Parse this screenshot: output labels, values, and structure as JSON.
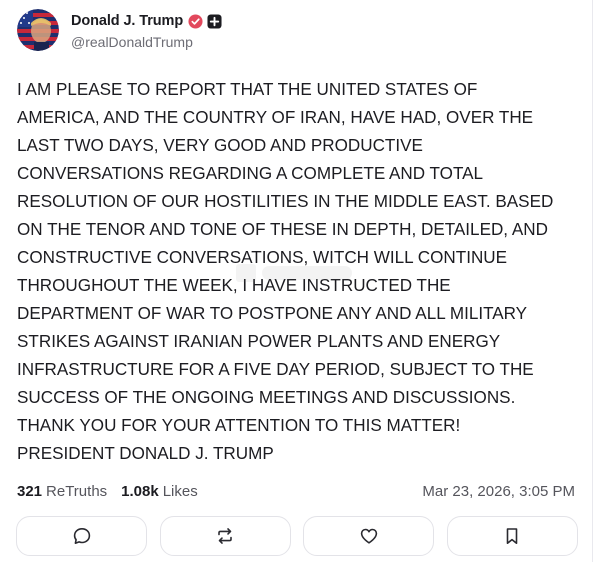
{
  "author": {
    "display_name": "Donald J. Trump",
    "handle": "@realDonaldTrump",
    "avatar_icon": "avatar-flag-portrait",
    "verified_icon": "verified-badge-icon",
    "plus_icon": "plus-badge-icon"
  },
  "post": {
    "text": "I AM PLEASE TO REPORT THAT THE UNITED STATES OF\nAMERICA, AND THE COUNTRY OF IRAN, HAVE HAD, OVER THE\nLAST TWO DAYS, VERY GOOD AND PRODUCTIVE\nCONVERSATIONS REGARDING A COMPLETE AND TOTAL\nRESOLUTION OF OUR HOSTILITIES IN THE MIDDLE EAST. BASED\nON THE TENOR AND TONE OF THESE IN DEPTH, DETAILED, AND\nCONSTRUCTIVE CONVERSATIONS, WITCH WILL CONTINUE\nTHROUGHOUT THE WEEK, I HAVE INSTRUCTED THE\nDEPARTMENT OF WAR TO POSTPONE ANY AND ALL MILITARY\nSTRIKES AGAINST IRANIAN POWER PLANTS AND ENERGY\nINFRASTRUCTURE FOR A FIVE DAY PERIOD, SUBJECT TO THE\nSUCCESS OF THE ONGOING MEETINGS AND DISCUSSIONS.\nTHANK YOU FOR YOUR ATTENTION TO THIS MATTER!\nPRESIDENT DONALD J. TRUMP"
  },
  "stats": {
    "retruths_count": "321",
    "retruths_label": "ReTruths",
    "likes_count": "1.08k",
    "likes_label": "Likes",
    "timestamp": "Mar 23, 2026, 3:05 PM"
  },
  "actions": [
    {
      "icon": "reply-icon"
    },
    {
      "icon": "retruth-icon"
    },
    {
      "icon": "like-heart-icon"
    },
    {
      "icon": "bookmark-icon"
    }
  ],
  "colors": {
    "verified": "#e2485c",
    "text": "#1c1c21",
    "muted": "#6d6d75",
    "border": "#e3e3e8"
  }
}
